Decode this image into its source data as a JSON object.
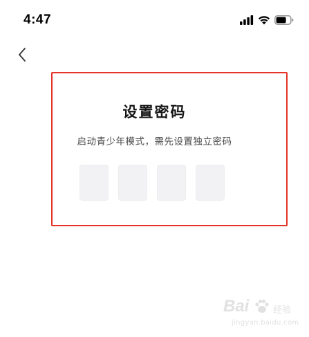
{
  "status_bar": {
    "time": "4:47",
    "icons": [
      "cellular-signal-icon",
      "wifi-icon",
      "battery-icon"
    ]
  },
  "nav": {
    "back_icon": "chevron-left-icon"
  },
  "dialog": {
    "title": "设置密码",
    "subtitle": "启动青少年模式，需先设置独立密码",
    "pin_slots": [
      "",
      "",
      "",
      ""
    ]
  },
  "annotation": {
    "border_color": "#e53328"
  },
  "watermark": {
    "brand": "Bai",
    "product": "经验",
    "url": "jingyan.baidu.com"
  }
}
